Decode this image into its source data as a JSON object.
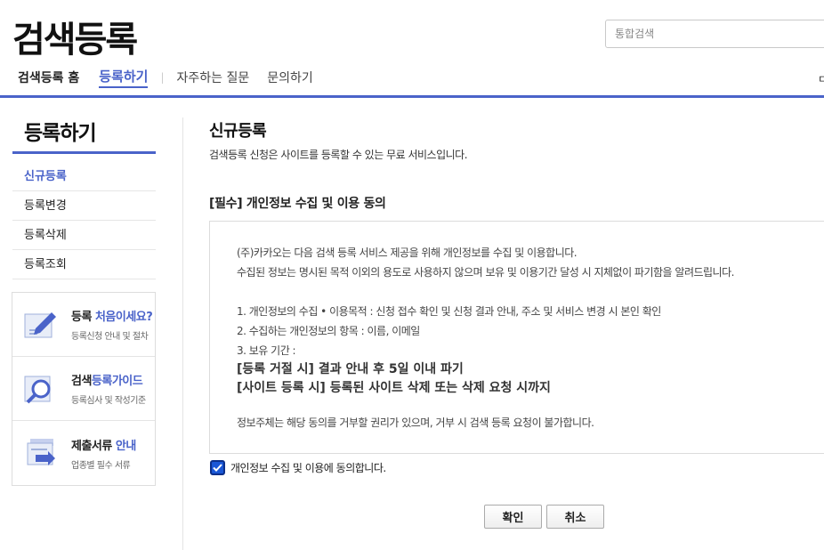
{
  "header": {
    "logo": "검색등록",
    "search_placeholder": "통합검색",
    "right_fragment": "ㅁ"
  },
  "gnb": {
    "home": "검색등록 홈",
    "register": "등록하기",
    "faq": "자주하는 질문",
    "contact": "문의하기"
  },
  "sidebar": {
    "title": "등록하기",
    "items": [
      {
        "label": "신규등록"
      },
      {
        "label": "등록변경"
      },
      {
        "label": "등록삭제"
      },
      {
        "label": "등록조회"
      }
    ],
    "banners": [
      {
        "title_a": "등록 ",
        "title_b": "처음이세요?",
        "sub": "등록신청 안내 및 절차",
        "icon": "pencil-doc-icon"
      },
      {
        "title_a": "검색",
        "title_b": "등록가이드",
        "sub": "등록심사 및 작성기준",
        "icon": "magnifier-doc-icon"
      },
      {
        "title_a": "제출서류 ",
        "title_b": "안내",
        "sub": "업종별 필수 서류",
        "icon": "documents-arrow-icon"
      }
    ]
  },
  "content": {
    "title": "신규등록",
    "desc": "검색등록 신청은 사이트를 등록할 수 있는 무료 서비스입니다.",
    "subtitle": "[필수] 개인정보 수집 및 이용 동의",
    "agree": {
      "l1": "(주)카카오는 다음 검색 등록 서비스 제공을 위해 개인정보를 수집 및 이용합니다.",
      "l2": "수집된 정보는 명시된 목적 이외의 용도로 사용하지 않으며 보유 및 이용기간 달성 시 지체없이 파기함을 알려드립니다.",
      "l3": "1. 개인정보의 수집 • 이용목적 : 신청 접수 확인 및 신청 결과 안내, 주소 및 서비스 변경 시 본인 확인",
      "l4": "2. 수집하는 개인정보의 항목 : 이름, 이메일",
      "l5": "3. 보유 기간 :",
      "l6": "[등록 거절 시] 결과 안내 후 5일 이내 파기",
      "l7": "[사이트 등록 시] 등록된 사이트 삭제 또는 삭제 요청 시까지",
      "l8": "정보주체는 해당 동의를 거부할 권리가 있으며, 거부 시 검색 등록 요청이 불가합니다."
    },
    "checkbox_label": "개인정보 수집 및 이용에 동의합니다.",
    "checked": true,
    "ok": "확인",
    "cancel": "취소"
  },
  "colors": {
    "accent": "#4a63c9",
    "checkbox": "#1a57d6"
  }
}
